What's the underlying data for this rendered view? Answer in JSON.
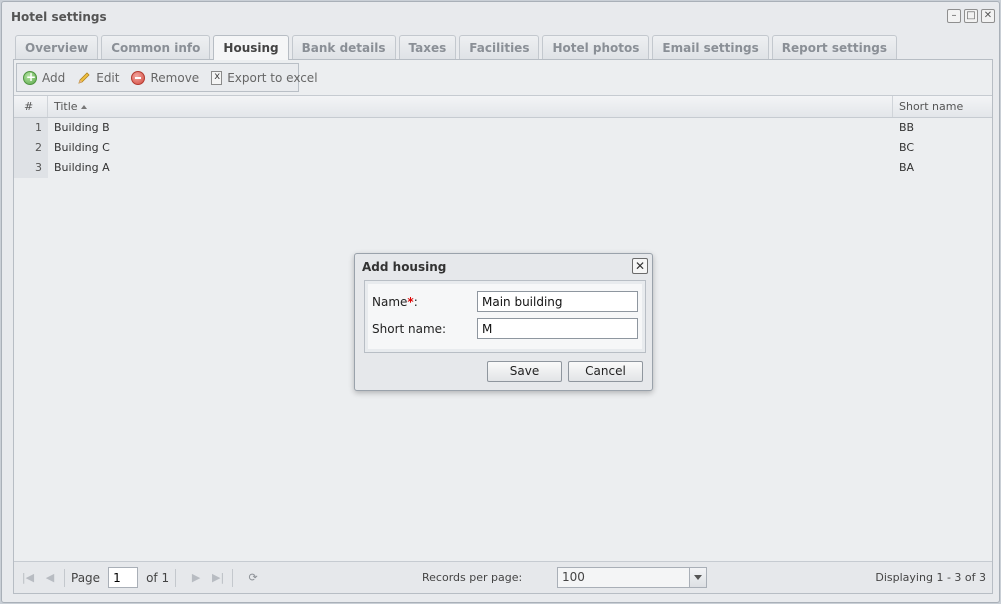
{
  "window": {
    "title": "Hotel settings"
  },
  "tabs": [
    {
      "label": "Overview"
    },
    {
      "label": "Common info"
    },
    {
      "label": "Housing"
    },
    {
      "label": "Bank details"
    },
    {
      "label": "Taxes"
    },
    {
      "label": "Facilities"
    },
    {
      "label": "Hotel photos"
    },
    {
      "label": "Email settings"
    },
    {
      "label": "Report settings"
    }
  ],
  "active_tab": "Housing",
  "toolbar": {
    "add_label": "Add",
    "edit_label": "Edit",
    "remove_label": "Remove",
    "export_label": "Export to excel"
  },
  "grid": {
    "columns": {
      "num": "#",
      "title": "Title",
      "short": "Short name"
    },
    "sort": {
      "column": "Title",
      "direction": "ascending"
    },
    "rows": [
      {
        "num": "1",
        "title": "Building B",
        "short": "BB"
      },
      {
        "num": "2",
        "title": "Building C",
        "short": "BC"
      },
      {
        "num": "3",
        "title": "Building A",
        "short": "BA"
      }
    ]
  },
  "pager": {
    "page_label": "Page",
    "page_value": "1",
    "of_label": "of 1",
    "records_per_page_label": "Records per page:",
    "records_per_page_value": "100",
    "display_text": "Displaying 1 - 3 of 3"
  },
  "dialog": {
    "title": "Add housing",
    "name_label": "Name",
    "name_required_mark": "*",
    "name_colon": ":",
    "name_value": "Main building",
    "short_label": "Short name:",
    "short_value": "M",
    "save_label": "Save",
    "cancel_label": "Cancel"
  },
  "colors": {
    "required": "#dd0000",
    "window_bg": "#e8eaed"
  }
}
